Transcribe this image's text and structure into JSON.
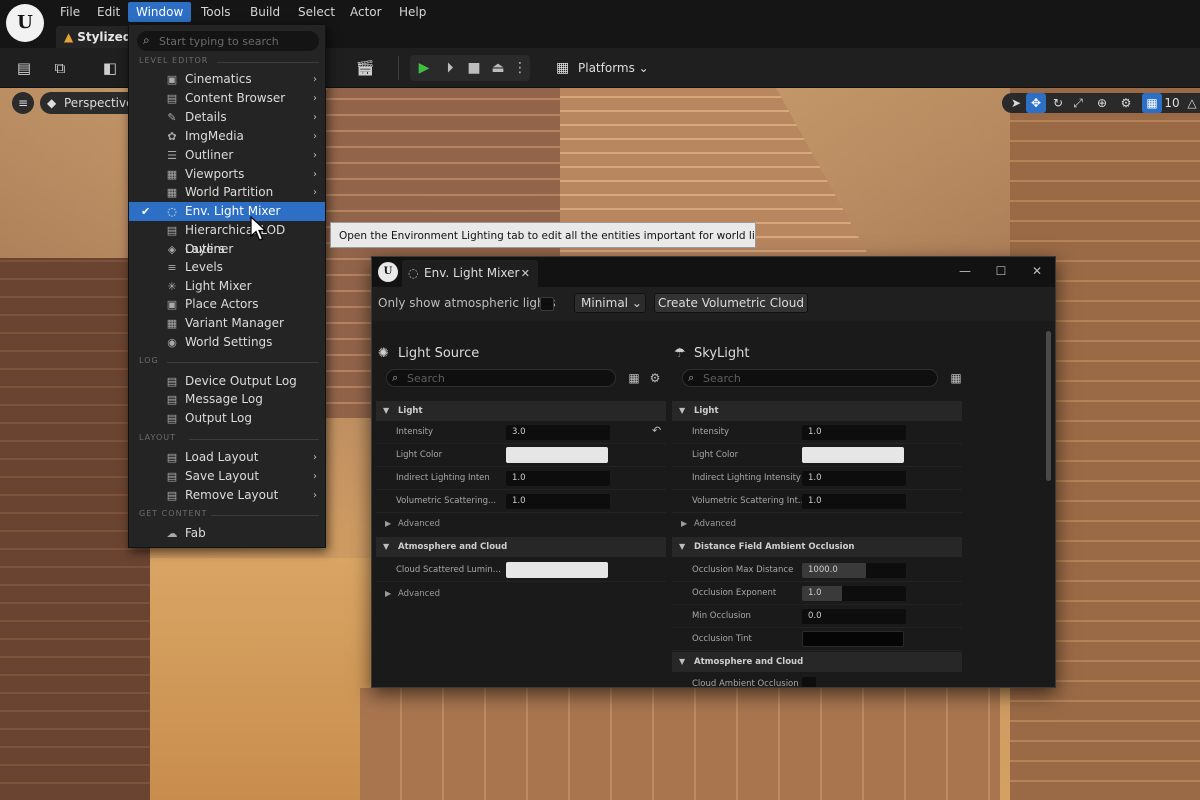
{
  "app": {
    "logo": "U",
    "menus": [
      "File",
      "Edit",
      "Window",
      "Tools",
      "Build",
      "Select",
      "Actor",
      "Help"
    ],
    "project_tab": "Stylized",
    "accent": "#2c6fc4"
  },
  "toolbar": {
    "platforms_label": "Platforms",
    "icons": [
      "save-icon",
      "browse-icon",
      "mode-icon",
      "cinematics-icon",
      "play-icon",
      "step-icon",
      "stop-icon",
      "eject-icon",
      "more-icon",
      "platforms-icon"
    ]
  },
  "viewport": {
    "perspective_label": "Perspective",
    "grid_value": "10"
  },
  "window_menu": {
    "search_placeholder": "Start typing to search",
    "sections": {
      "level_editor": "LEVEL EDITOR",
      "log": "LOG",
      "layout": "LAYOUT",
      "get_content": "GET CONTENT"
    },
    "items": [
      {
        "label": "Cinematics",
        "icon": "▣",
        "submenu": true
      },
      {
        "label": "Content Browser",
        "icon": "▤",
        "submenu": true
      },
      {
        "label": "Details",
        "icon": "✎",
        "submenu": true
      },
      {
        "label": "ImgMedia",
        "icon": "✿",
        "submenu": true
      },
      {
        "label": "Outliner",
        "icon": "☰",
        "submenu": true
      },
      {
        "label": "Viewports",
        "icon": "▦",
        "submenu": true
      },
      {
        "label": "World Partition",
        "icon": "▦",
        "submenu": true
      },
      {
        "label": "Env. Light Mixer",
        "icon": "◌",
        "submenu": false,
        "checked": true,
        "highlighted": true
      },
      {
        "label": "Hierarchical LOD Outliner",
        "icon": "▤",
        "submenu": false
      },
      {
        "label": "Layers",
        "icon": "◈",
        "submenu": false
      },
      {
        "label": "Levels",
        "icon": "≡",
        "submenu": false
      },
      {
        "label": "Light Mixer",
        "icon": "✳",
        "submenu": false
      },
      {
        "label": "Place Actors",
        "icon": "▣",
        "submenu": false
      },
      {
        "label": "Variant Manager",
        "icon": "▦",
        "submenu": false
      },
      {
        "label": "World Settings",
        "icon": "◉",
        "submenu": false
      }
    ],
    "log_items": [
      {
        "label": "Device Output Log",
        "icon": "▤"
      },
      {
        "label": "Message Log",
        "icon": "▤"
      },
      {
        "label": "Output Log",
        "icon": "▤"
      }
    ],
    "layout_items": [
      {
        "label": "Load Layout",
        "icon": "▤",
        "submenu": true
      },
      {
        "label": "Save Layout",
        "icon": "▤",
        "submenu": true
      },
      {
        "label": "Remove Layout",
        "icon": "▤",
        "submenu": true
      }
    ],
    "content_items": [
      {
        "label": "Fab",
        "icon": "☁"
      }
    ]
  },
  "tooltip": "Open the Environment Lighting tab to edit all the entities important for world lighting.",
  "mixer": {
    "tab_label": "Env. Light Mixer",
    "only_atmo_label": "Only show atmospheric lights",
    "only_atmo_checked": false,
    "view_mode": "Minimal",
    "create_cloud_label": "Create Volumetric Cloud",
    "search_placeholder": "Search",
    "light_source": {
      "title": "Light Source",
      "cat_light": "Light",
      "intensity_label": "Intensity",
      "intensity": "3.0",
      "light_color_label": "Light Color",
      "light_color": "#e6e6e6",
      "indirect_label": "Indirect Lighting Inten",
      "indirect": "1.0",
      "volumetric_label": "Volumetric Scattering...",
      "volumetric": "1.0",
      "advanced": "Advanced",
      "cat_atmo": "Atmosphere and Cloud",
      "cloud_scattered_label": "Cloud Scattered Lumin...",
      "cloud_scattered_color": "#e6e6e6",
      "advanced2": "Advanced"
    },
    "skylight": {
      "title": "SkyLight",
      "cat_light": "Light",
      "intensity_label": "Intensity",
      "intensity": "1.0",
      "light_color_label": "Light Color",
      "light_color": "#e6e6e6",
      "indirect_label": "Indirect Lighting Intensity",
      "indirect": "1.0",
      "volumetric_label": "Volumetric Scattering Int...",
      "volumetric": "1.0",
      "advanced": "Advanced",
      "cat_dfao": "Distance Field Ambient Occlusion",
      "occ_max_label": "Occlusion Max Distance",
      "occ_max": "1000.0",
      "occ_max_fill": 0.62,
      "occ_exp_label": "Occlusion Exponent",
      "occ_exp": "1.0",
      "occ_exp_fill": 0.38,
      "min_occ_label": "Min Occlusion",
      "min_occ": "0.0",
      "occ_tint_label": "Occlusion Tint",
      "occ_tint_color": "#050505",
      "cat_atmo": "Atmosphere and Cloud",
      "cloud_ambient_label": "Cloud Ambient Occlusion"
    }
  }
}
